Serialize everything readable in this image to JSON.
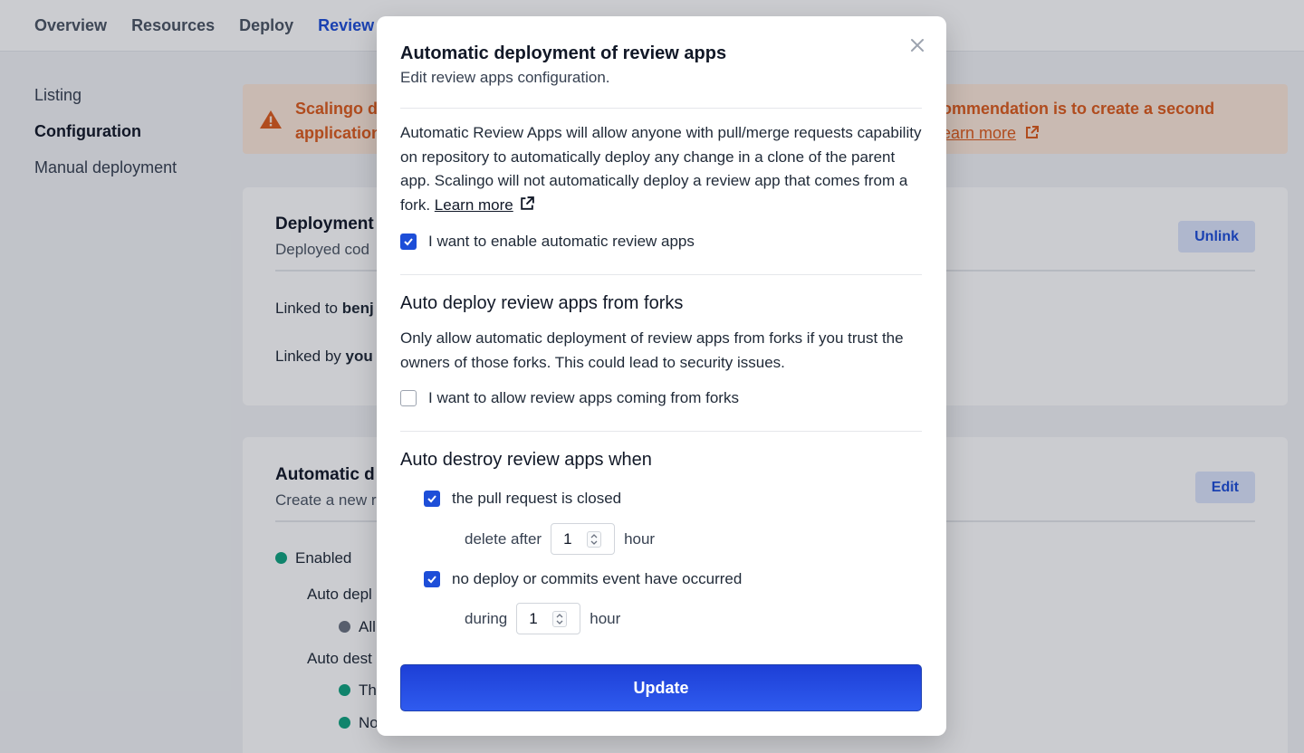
{
  "colors": {
    "accent": "#1d4ed8",
    "warning": "#dd5b1c",
    "success": "#10a37f"
  },
  "topnav": {
    "tabs": [
      "Overview",
      "Resources",
      "Deploy",
      "Review a"
    ]
  },
  "sidebar": {
    "items": [
      "Listing",
      "Configuration",
      "Manual deployment"
    ]
  },
  "alert": {
    "icon": "warning-icon",
    "left_line1": "Scalingo d",
    "left_line2": "application",
    "right_line1": "ommendation is to create a second",
    "right_line2_link": "earn more"
  },
  "card1": {
    "title": "Deployment",
    "subtitle": "Deployed cod",
    "unlink_label": "Unlink",
    "linked_to_label": "Linked to",
    "linked_to_value": "benj",
    "linked_by_label": "Linked by",
    "linked_by_value": "you"
  },
  "card2": {
    "title": "Automatic d",
    "subtitle": "Create a new r",
    "edit_label": "Edit",
    "status": "Enabled",
    "auto_deploy_label": "Auto depl",
    "auto_deploy_item": "All",
    "auto_destroy_label": "Auto dest",
    "destroy_item1": "Th",
    "destroy_item2": "No"
  },
  "modal": {
    "title": "Automatic deployment of review apps",
    "subtitle": "Edit review apps configuration.",
    "intro": "Automatic Review Apps will allow anyone with pull/merge requests capability on repository to automatically deploy any change in a clone of the parent app. Scalingo will not automatically deploy a review app that comes from a fork.",
    "learn_more": "Learn more",
    "enable_label": "I want to enable automatic review apps",
    "enable_checked": true,
    "forks_heading": "Auto deploy review apps from forks",
    "forks_desc": "Only allow automatic deployment of review apps from forks if you trust the owners of those forks. This could lead to security issues.",
    "forks_label": "I want to allow review apps coming from forks",
    "forks_checked": false,
    "destroy_heading": "Auto destroy review apps when",
    "pr_closed_label": "the pull request is closed",
    "pr_closed_checked": true,
    "delete_after_label": "delete after",
    "delete_after_value": "1",
    "delete_after_unit": "hour",
    "no_activity_label": "no deploy or commits event have occurred",
    "no_activity_checked": true,
    "during_label": "during",
    "during_value": "1",
    "during_unit": "hour",
    "update_label": "Update"
  }
}
